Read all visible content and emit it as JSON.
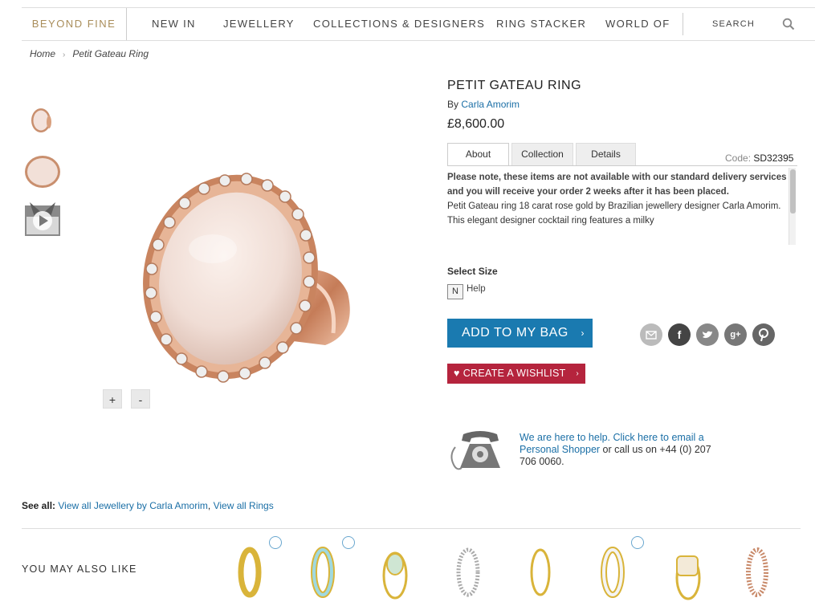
{
  "nav": {
    "brand": "BEYOND FINE",
    "items": [
      "NEW IN",
      "JEWELLERY",
      "COLLECTIONS & DESIGNERS",
      "RING STACKER",
      "WORLD OF"
    ],
    "search_placeholder": "SEARCH"
  },
  "breadcrumb": {
    "home": "Home",
    "current": "Petit Gateau Ring"
  },
  "product": {
    "title": "PETIT GATEAU RING",
    "by_label": "By",
    "designer": "Carla Amorim",
    "price": "£8,600.00",
    "code_label": "Code:",
    "code": "SD32395",
    "tabs": [
      "About",
      "Collection",
      "Details"
    ],
    "notice": "Please note, these items are not available with our standard delivery services and you will receive your order 2 weeks after it has been placed.",
    "description": "Petit Gateau ring 18 carat rose gold by Brazilian jewellery designer Carla Amorim. This elegant designer cocktail ring features a milky",
    "size_label": "Select Size",
    "size_value": "N",
    "help_label": "Help",
    "add_to_bag": "ADD TO MY BAG",
    "wishlist": "CREATE A WISHLIST"
  },
  "zoom": {
    "plus": "+",
    "minus": "-"
  },
  "social": [
    "email-icon",
    "facebook-icon",
    "twitter-icon",
    "google-plus-icon",
    "pinterest-icon"
  ],
  "help_box": {
    "link_text": "We are here to help. Click here to email a Personal Shopper",
    "rest_text": " or call us on +44 (0) 207 706 0060."
  },
  "see_all": {
    "label": "See all:",
    "link1": "View all Jewellery by Carla Amorim",
    "sep": ",",
    "link2": "View all Rings"
  },
  "may_like": {
    "label": "YOU MAY ALSO LIKE"
  },
  "colors": {
    "brand_gold": "#a98d5a",
    "link_blue": "#1b6fa6",
    "bag_blue": "#1a7ab0",
    "wish_red": "#b5243d"
  }
}
